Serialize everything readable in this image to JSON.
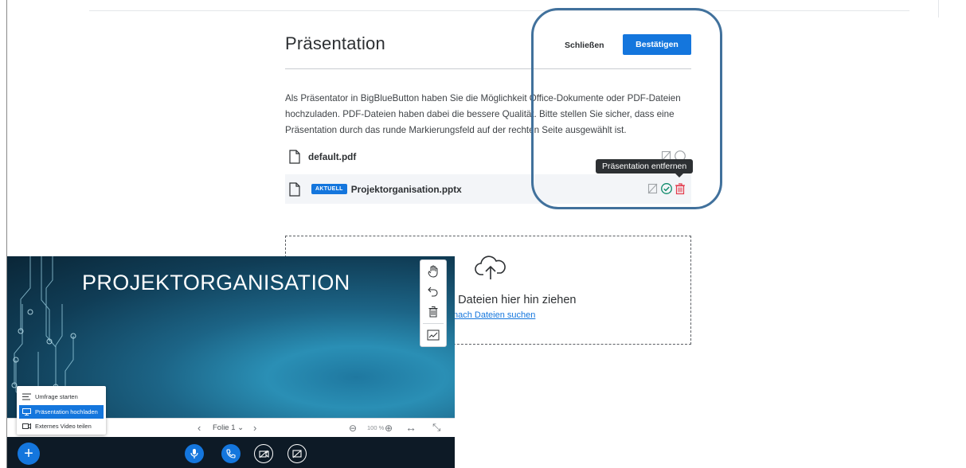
{
  "modal": {
    "title": "Präsentation",
    "close_label": "Schließen",
    "confirm_label": "Bestätigen",
    "description": "Als Präsentator in BigBlueButton haben Sie die Möglichkeit Office-Dokumente oder PDF-Dateien hochzuladen. PDF-Dateien haben dabei die bessere Qualität. Bitte stellen Sie sicher, dass eine Präsentation durch das runde Markierungsfeld auf der rechten Seite ausgewählt ist.",
    "files": [
      {
        "name": "default.pdf",
        "current": false
      },
      {
        "name": "Projektorganisation.pptx",
        "current": true,
        "badge": "AKTUELL"
      }
    ],
    "tooltip": "Präsentation entfernen",
    "dropzone": {
      "text": "de Dateien hier hin ziehen",
      "link": "nach Dateien suchen"
    }
  },
  "presentation": {
    "slide_title": "PROJEKTORGANISATION",
    "folie_label": "Folie 1",
    "zoom_label": "100 %"
  },
  "actions_menu": {
    "items": [
      {
        "label": "Umfrage starten",
        "icon": "poll-icon"
      },
      {
        "label": "Präsentation hochladen",
        "icon": "presentation-icon",
        "selected": true
      },
      {
        "label": "Externes Video teilen",
        "icon": "video-icon"
      }
    ]
  },
  "colors": {
    "accent": "#1476dd",
    "highlight": "#41719c",
    "delete": "#e3394a",
    "check": "#0d8a6a"
  }
}
